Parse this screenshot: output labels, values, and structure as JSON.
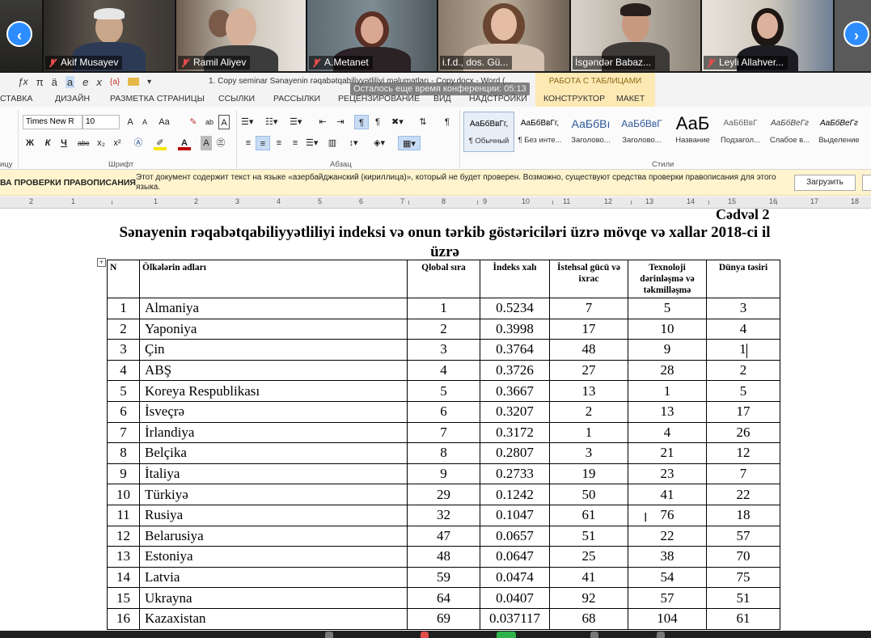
{
  "meeting": {
    "participants": [
      {
        "name": "Akif Musayev"
      },
      {
        "name": "Ramil Aliyev"
      },
      {
        "name": "A.Metanet"
      },
      {
        "name": "i.f.d., dos. Gü..."
      },
      {
        "name": "İsgəndər Babaz..."
      },
      {
        "name": "Leyli Allahver..."
      }
    ],
    "prev_icon": "chevron-left-icon",
    "next_icon": "chevron-right-icon",
    "notice": "Осталось еще время конференции: 05:13"
  },
  "word": {
    "doc_title": "1. Copy seminar Sənayenin rəqabətqabiliyyətliliyi məlumatları - Copy.docx - Word (...",
    "context_title": "РАБОТА С ТАБЛИЦАМИ",
    "qat_symbols": [
      "ƒx",
      "π",
      "ä",
      "a",
      "e",
      "x",
      "{a}",
      "▾"
    ],
    "tabs": [
      "СТАВКА",
      "ДИЗАЙН",
      "РАЗМЕТКА СТРАНИЦЫ",
      "ССЫЛКИ",
      "РАССЫЛКИ",
      "РЕЦЕНЗИРОВАНИЕ",
      "ВИД",
      "НАДСТРОЙКИ",
      "КОНСТРУКТОР",
      "МАКЕТ"
    ],
    "font_name": "Times New R",
    "font_size": "10",
    "group_labels": {
      "clipboard": "ицу",
      "font": "Шрифт",
      "paragraph": "Абзац",
      "styles": "Стили"
    },
    "font_buttons": [
      "A",
      "A",
      "Aa",
      "ab",
      "A"
    ],
    "format_buttons": [
      "Ж",
      "К",
      "Ч",
      "abc",
      "x₂",
      "x²"
    ],
    "styles": [
      {
        "sample": "АаБбВвГг,",
        "name": "¶ Обычный"
      },
      {
        "sample": "АаБбВвГг,",
        "name": "¶ Без инте..."
      },
      {
        "sample": "АаБбВı",
        "name": "Заголово..."
      },
      {
        "sample": "АаБбВвГ",
        "name": "Заголово..."
      },
      {
        "sample": "АаБ",
        "name": "Название"
      },
      {
        "sample": "АаБбВвГ",
        "name": "Подзагол..."
      },
      {
        "sample": "АаБбВеГг",
        "name": "Слабое в..."
      },
      {
        "sample": "АаБбВеГг",
        "name": "Выделение"
      }
    ],
    "infobar": {
      "title": "ВА ПРОВЕРКИ ПРАВОПИСАНИЯ",
      "message": "Этот документ содержит текст на языке «азербайджанский (кириллица)», который не будет проверен. Возможно, существуют средства проверки правописания для этого языка.",
      "button": "Загрузить"
    },
    "ruler_numbers": [
      "2",
      "1",
      "1",
      "2",
      "3",
      "4",
      "5",
      "6",
      "7",
      "8",
      "9",
      "10",
      "11",
      "12",
      "13",
      "14",
      "15",
      "16",
      "17",
      "18"
    ]
  },
  "document": {
    "caption": "Cədvəl 2",
    "heading": "Sənayenin rəqabətqabiliyyətliliyi indeksi və onun tərkib göstəriciləri üzrə mövqe və xallar 2018-ci il üzrə",
    "columns": [
      "N",
      "Ölkələrin adları",
      "Qlobal sıra",
      "İndeks xalı",
      "İstehsal gücü və ixrac",
      "Texnoloji dərinləşmə və təkmilləşmə",
      "Dünya təsiri"
    ],
    "rows": [
      [
        "1",
        "Almaniya",
        "1",
        "0.5234",
        "7",
        "5",
        "3"
      ],
      [
        "2",
        "Yaponiya",
        "2",
        "0.3998",
        "17",
        "10",
        "4"
      ],
      [
        "3",
        "Çin",
        "3",
        "0.3764",
        "48",
        "9",
        "1"
      ],
      [
        "4",
        "ABŞ",
        "4",
        "0.3726",
        "27",
        "28",
        "2"
      ],
      [
        "5",
        "Koreya Respublikası",
        "5",
        "0.3667",
        "13",
        "1",
        "5"
      ],
      [
        "6",
        "İsveçrə",
        "6",
        "0.3207",
        "2",
        "13",
        "17"
      ],
      [
        "7",
        "İrlandiya",
        "7",
        "0.3172",
        "1",
        "4",
        "26"
      ],
      [
        "8",
        "Belçika",
        "8",
        "0.2807",
        "3",
        "21",
        "12"
      ],
      [
        "9",
        "İtaliya",
        "9",
        "0.2733",
        "19",
        "23",
        "7"
      ],
      [
        "10",
        "Türkiyə",
        "29",
        "0.1242",
        "50",
        "41",
        "22"
      ],
      [
        "11",
        "Rusiya",
        "32",
        "0.1047",
        "61",
        "76",
        "18"
      ],
      [
        "12",
        "Belarusiya",
        "47",
        "0.0657",
        "51",
        "22",
        "57"
      ],
      [
        "13",
        "Estoniya",
        "48",
        "0.0647",
        "25",
        "38",
        "70"
      ],
      [
        "14",
        "Latvia",
        "59",
        "0.0474",
        "41",
        "54",
        "75"
      ],
      [
        "15",
        "Ukrayna",
        "64",
        "0.0407",
        "92",
        "57",
        "51"
      ],
      [
        "16",
        "Kazaxistan",
        "69",
        "0.037117",
        "68",
        "104",
        "61"
      ]
    ]
  },
  "colors": {
    "accent": "#2d8cff",
    "context_tab": "#fde9b4",
    "infobar": "#fff4ce"
  }
}
